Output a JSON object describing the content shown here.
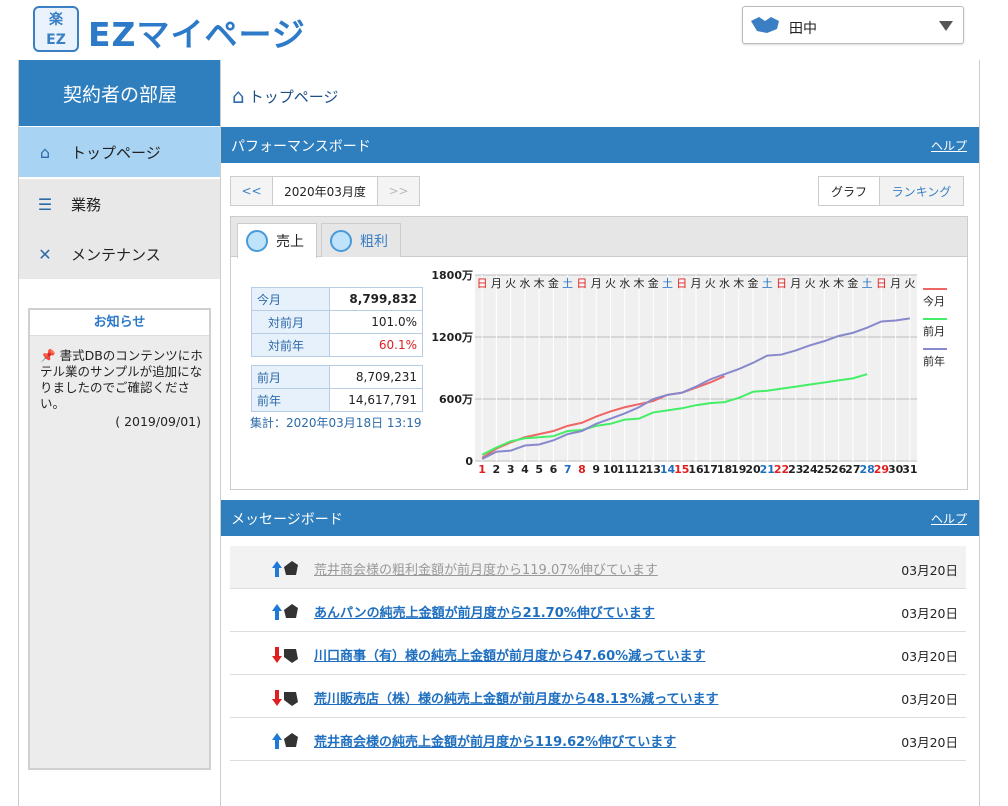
{
  "header": {
    "logo_mark": "楽\nEZ",
    "logo_text": "EZマイページ",
    "user_name": "田中"
  },
  "sidebar": {
    "title": "契約者の部屋",
    "items": [
      {
        "label": "トップページ",
        "icon": "home-icon"
      },
      {
        "label": "業務",
        "icon": "list-icon"
      },
      {
        "label": "メンテナンス",
        "icon": "tools-icon"
      }
    ],
    "notice": {
      "title": "お知らせ",
      "body": "書式DBのコンテンツにホテル業のサンプルが追加になりましたのでご確認ください。",
      "date": "( 2019/09/01)"
    }
  },
  "breadcrumb": "トップページ",
  "performance": {
    "title": "パフォーマンスボード",
    "help": "ヘルプ",
    "prev": "<<",
    "month": "2020年03月度",
    "next": ">>",
    "graph_btn": "グラフ",
    "ranking_btn": "ランキング",
    "tabs": [
      "売上",
      "粗利"
    ],
    "stats": {
      "this_month_label": "今月",
      "this_month": "8,799,832",
      "mom_label": "対前月",
      "mom": "101.0%",
      "yoy_label": "対前年",
      "yoy": "60.1%",
      "last_month_label": "前月",
      "last_month": "8,709,231",
      "last_year_label": "前年",
      "last_year": "14,617,791"
    },
    "calc": "集計：2020年03月18日  13:19"
  },
  "chart_data": {
    "type": "line",
    "x": [
      1,
      2,
      3,
      4,
      5,
      6,
      7,
      8,
      9,
      10,
      11,
      12,
      13,
      14,
      15,
      16,
      17,
      18,
      19,
      20,
      21,
      22,
      23,
      24,
      25,
      26,
      27,
      28,
      29,
      30,
      31
    ],
    "weekdays": [
      "日",
      "月",
      "火",
      "水",
      "木",
      "金",
      "土",
      "日",
      "月",
      "火",
      "水",
      "木",
      "金",
      "土",
      "日",
      "月",
      "火",
      "水",
      "木",
      "金",
      "土",
      "日",
      "月",
      "火",
      "水",
      "木",
      "金",
      "土",
      "日",
      "月",
      "火"
    ],
    "yticks": [
      {
        "v": 0,
        "label": "0"
      },
      {
        "v": 600,
        "label": "600万"
      },
      {
        "v": 1200,
        "label": "1200万"
      },
      {
        "v": 1800,
        "label": "1800万"
      }
    ],
    "ylim": [
      0,
      1800
    ],
    "series": [
      {
        "name": "今月",
        "color": "#ee6666",
        "values": [
          30,
          120,
          180,
          230,
          260,
          290,
          340,
          370,
          430,
          480,
          520,
          550,
          580,
          640,
          660,
          710,
          760,
          820
        ]
      },
      {
        "name": "前月",
        "color": "#44ee66",
        "values": [
          60,
          130,
          190,
          220,
          230,
          240,
          290,
          300,
          340,
          360,
          400,
          410,
          470,
          490,
          510,
          540,
          560,
          570,
          610,
          670,
          680,
          700,
          720,
          740,
          760,
          780,
          800,
          840
        ]
      },
      {
        "name": "前年",
        "color": "#8888cc",
        "values": [
          20,
          90,
          100,
          150,
          160,
          200,
          260,
          290,
          360,
          410,
          460,
          520,
          600,
          640,
          660,
          720,
          790,
          840,
          890,
          950,
          1020,
          1030,
          1070,
          1120,
          1160,
          1210,
          1240,
          1290,
          1350,
          1360,
          1380
        ]
      }
    ]
  },
  "messages": {
    "title": "メッセージボード",
    "help": "ヘルプ",
    "items": [
      {
        "text": "荒井商会様の粗利金額が前月度から119.07%伸びています",
        "date": "03月20日",
        "dir": "up",
        "read": true
      },
      {
        "text": "あんパンの純売上金額が前月度から21.70%伸びています",
        "date": "03月20日",
        "dir": "up",
        "read": false
      },
      {
        "text": "川口商事（有）様の純売上金額が前月度から47.60%減っています",
        "date": "03月20日",
        "dir": "down",
        "read": false
      },
      {
        "text": "荒川販売店（株）様の純売上金額が前月度から48.13%減っています",
        "date": "03月20日",
        "dir": "down",
        "read": false
      },
      {
        "text": "荒井商会様の純売上金額が前月度から119.62%伸びています",
        "date": "03月20日",
        "dir": "up",
        "read": false
      }
    ]
  }
}
